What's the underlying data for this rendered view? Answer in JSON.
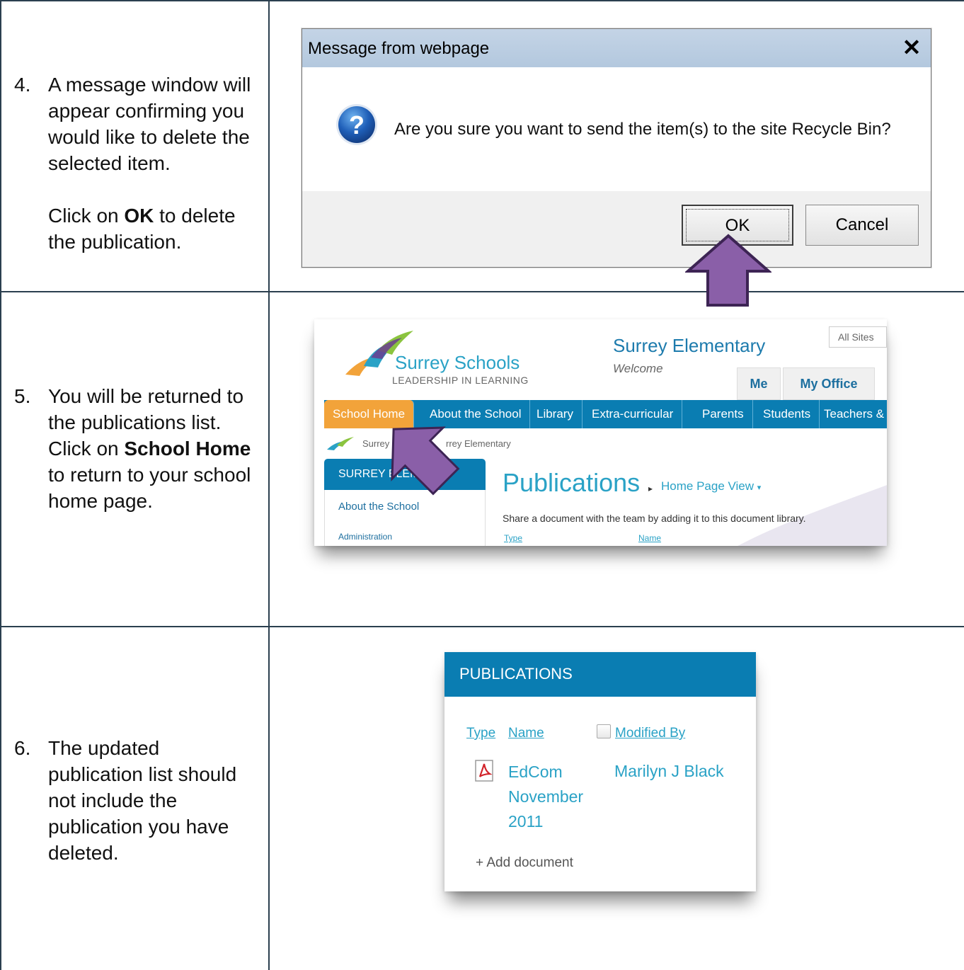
{
  "steps": [
    {
      "number": "4.",
      "text": "A message window will appear confirming you would like to delete the selected item.",
      "para2_pre": "Click on ",
      "para2_bold": "OK",
      "para2_post": " to delete the publication."
    },
    {
      "number": "5.",
      "pre": "You will be returned to the publications list. Click on ",
      "bold": "School Home",
      "post": " to return to your school home page."
    },
    {
      "number": "6.",
      "text": "The updated publication list should not include the publication you have deleted."
    }
  ],
  "dialog": {
    "title": "Message from webpage",
    "close_glyph": "✕",
    "message": "Are you sure you want to send the item(s) to the site Recycle Bin?",
    "ok_label": "OK",
    "cancel_label": "Cancel",
    "icon": "question-icon"
  },
  "site": {
    "logo_name": "Surrey Schools",
    "logo_tagline": "LEADERSHIP IN LEARNING",
    "title": "Surrey Elementary",
    "welcome": "Welcome",
    "all_sites": "All Sites",
    "tabs": [
      "Me",
      "My Office"
    ],
    "nav": [
      "School Home",
      "About the School",
      "Library",
      "Extra-curricular",
      "Parents",
      "Students",
      "Teachers &"
    ],
    "breadcrumb_a": "Surrey S",
    "breadcrumb_b": "rrey Elementary",
    "sidebar_title": "SURREY ELEME   ARY",
    "sidebar_items": [
      "About the School",
      "Administration"
    ],
    "page_title": "Publications",
    "view_label": "Home Page View",
    "description": "Share a document with the team by adding it to this document library.",
    "col_type": "Type",
    "col_name": "Name",
    "accent_color": "#0a7db2",
    "active_color": "#f2a33a"
  },
  "publications": {
    "heading": "PUBLICATIONS",
    "col_type": "Type",
    "col_name": "Name",
    "col_modified": "Modified By",
    "doc_name": "EdCom November 2011",
    "modified_by": "Marilyn J Black",
    "add_label": "+ Add document",
    "icon": "pdf-icon"
  }
}
